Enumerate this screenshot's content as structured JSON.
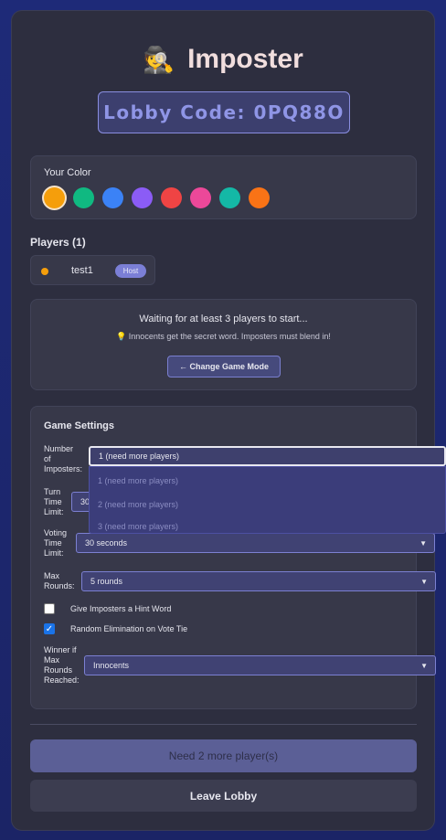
{
  "header": {
    "title": "Imposter",
    "emoji": "🕵"
  },
  "lobby": {
    "code_text": "Lobby Code: 0PQ88O"
  },
  "color_picker": {
    "label": "Your Color",
    "selected_color": "#f59e0b",
    "colors": [
      "#f59e0b",
      "#10b981",
      "#3b82f6",
      "#8b5cf6",
      "#ef4444",
      "#ec4899",
      "#14b8a6",
      "#f97316"
    ]
  },
  "players": {
    "label": "Players (1)",
    "list": [
      {
        "name": "test1",
        "badge": "Host",
        "color": "#f59e0b"
      }
    ]
  },
  "waiting": {
    "message": "Waiting for at least 3 players to start...",
    "hint": "Innocents get the secret word. Imposters must blend in!",
    "hint_icon": "💡",
    "change_mode_label": "← Change Game Mode"
  },
  "settings": {
    "heading": "Game Settings",
    "num_imposters": {
      "label": "Number of Imposters:",
      "value": "1 (need more players)",
      "options": [
        "1 (need more players)",
        "2 (need more players)",
        "3 (need more players)"
      ]
    },
    "turn_time": {
      "label": "Turn Time Limit:",
      "value": "30 seconds"
    },
    "voting_time": {
      "label": "Voting Time Limit:",
      "value": "30 seconds"
    },
    "max_rounds": {
      "label": "Max Rounds:",
      "value": "5 rounds"
    },
    "hint_word": {
      "label": "Give Imposters a Hint Word",
      "checked": false
    },
    "random_elim": {
      "label": "Random Elimination on Vote Tie",
      "checked": true
    },
    "winner": {
      "label": "Winner if Max Rounds Reached:",
      "value": "Innocents"
    }
  },
  "actions": {
    "need_players_label": "Need 2 more player(s)",
    "leave_label": "Leave Lobby"
  }
}
